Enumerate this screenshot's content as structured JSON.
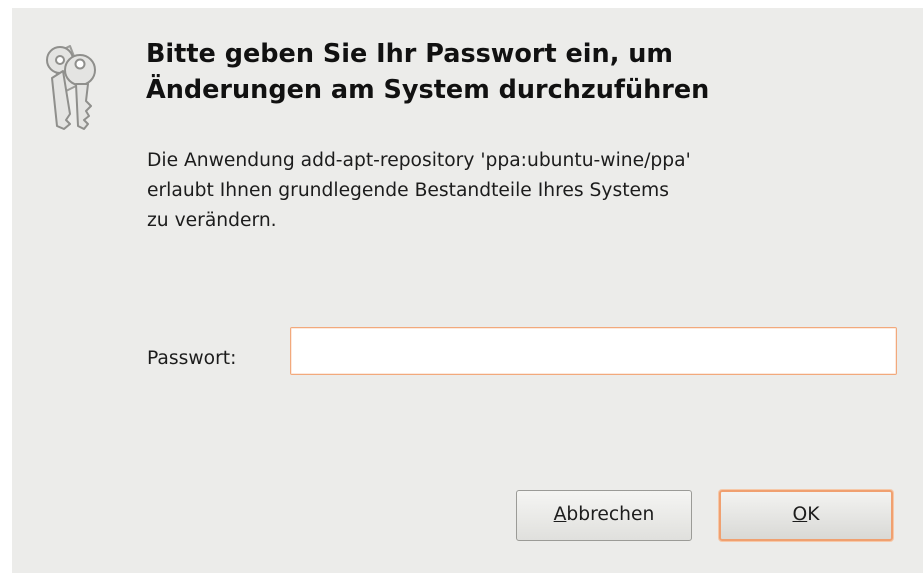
{
  "dialog": {
    "icon": "keys-icon",
    "heading_line1": "Bitte geben Sie Ihr Passwort ein, um",
    "heading_line2": "Änderungen am System durchzuführen",
    "message": "Die Anwendung add-apt-repository 'ppa:ubuntu-wine/ppa'\nerlaubt Ihnen grundlegende Bestandteile Ihres Systems\nzu verändern.",
    "password_label": "Passwort:",
    "password_value": "",
    "cancel_button": {
      "mnemonic": "A",
      "rest": "bbrechen"
    },
    "ok_button": {
      "mnemonic": "O",
      "rest": "K"
    }
  },
  "colors": {
    "dialog_background": "#ececea",
    "focus_accent": "#f0a070"
  }
}
